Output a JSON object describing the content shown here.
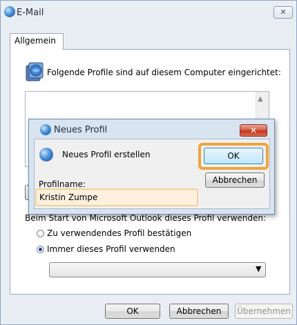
{
  "window": {
    "title": "E-Mail",
    "close_label": "✕",
    "tab_label": "Allgemein",
    "profiles_text": "Folgende Profile sind auf diesem Computer eingerichtet:",
    "startup_text": "Beim Start von Microsoft Outlook dieses Profil verwenden:",
    "radio_confirm_label": "Zu verwendendes Profil bestätigen",
    "radio_always_label": "Immer dieses Profil verwenden",
    "radio_selected": "always",
    "select_arrow": "▼",
    "ok_label": "OK",
    "cancel_label": "Abbrechen",
    "apply_label": "Übernehmen"
  },
  "dialog": {
    "title": "Neues Profil",
    "close_label": "✕",
    "create_text": "Neues Profil erstellen",
    "name_label": "Profilname:",
    "name_value": "Kristin Zumpe",
    "ok_label": "OK",
    "cancel_label": "Abbrechen"
  },
  "colors": {
    "highlight": "#f0a33c",
    "window_bg": "#e9eef4",
    "dialog_close": "#c1351d"
  },
  "icons": {
    "window": "outlook-globe-icon",
    "profiles": "profiles-icon",
    "dialog": "outlook-globe-icon"
  }
}
